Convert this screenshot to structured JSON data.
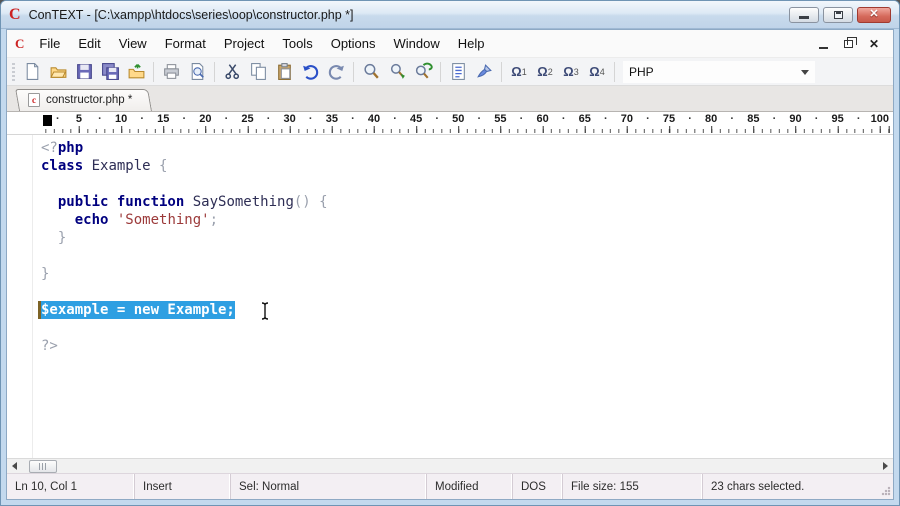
{
  "window": {
    "title": "ConTEXT - [C:\\xampp\\htdocs\\series\\oop\\constructor.php *]"
  },
  "icons": {
    "logo": "C",
    "tab_badge": "c",
    "close": "✕",
    "omega": "Ω"
  },
  "menubar": {
    "items": [
      "File",
      "Edit",
      "View",
      "Format",
      "Project",
      "Tools",
      "Options",
      "Window",
      "Help"
    ]
  },
  "toolbar": {
    "icon_names": [
      "new-file",
      "open-file",
      "save-file",
      "save-all",
      "open-folder",
      "print",
      "print-preview",
      "cut",
      "copy",
      "paste",
      "undo",
      "redo",
      "find",
      "find-next",
      "replace",
      "view-source",
      "format-brush",
      "user-function-1",
      "user-function-2",
      "user-function-3",
      "user-function-4"
    ],
    "omega_buttons": [
      {
        "glyph": "Ω",
        "sub": "1"
      },
      {
        "glyph": "Ω",
        "sub": "2"
      },
      {
        "glyph": "Ω",
        "sub": "3"
      },
      {
        "glyph": "Ω",
        "sub": "4"
      }
    ],
    "highlighter": {
      "value": "PHP"
    }
  },
  "tab": {
    "label": "constructor.php *"
  },
  "ruler": {
    "numbers": [
      5,
      10,
      15,
      20,
      25,
      30,
      35,
      40,
      45,
      50,
      55,
      60,
      65,
      70,
      75,
      80,
      85,
      90,
      95,
      100
    ],
    "cursor_col": 1
  },
  "editor": {
    "selection_colors": {
      "background": "#2e9fe2",
      "text": "#ffffff"
    },
    "token_colors": {
      "keyword": "#00007f",
      "identifier": "#2e2e55",
      "string": "#9c3a3a",
      "symbol": "#9aa0ad"
    },
    "lines": [
      [
        {
          "t": "<?",
          "c": "sym"
        },
        {
          "t": "php",
          "c": "kw"
        }
      ],
      [
        {
          "t": "class",
          "c": "kw"
        },
        {
          "t": " Example ",
          "c": "id"
        },
        {
          "t": "{",
          "c": "sym"
        }
      ],
      [],
      [
        {
          "t": "  ",
          "c": "id"
        },
        {
          "t": "public function",
          "c": "kw"
        },
        {
          "t": " SaySomething",
          "c": "id"
        },
        {
          "t": "()",
          "c": "sym"
        },
        {
          "t": " {",
          "c": "sym"
        }
      ],
      [
        {
          "t": "    ",
          "c": "id"
        },
        {
          "t": "echo",
          "c": "kw"
        },
        {
          "t": " ",
          "c": "id"
        },
        {
          "t": "'Something'",
          "c": "str"
        },
        {
          "t": ";",
          "c": "sym"
        }
      ],
      [
        {
          "t": "  }",
          "c": "sym"
        }
      ],
      [],
      [
        {
          "t": "}",
          "c": "sym"
        }
      ],
      [],
      [
        {
          "t": "$example = new Example;",
          "c": "sel"
        }
      ],
      [],
      [
        {
          "t": "?>",
          "c": "sym"
        }
      ]
    ]
  },
  "statusbar": {
    "panels": [
      "Ln 10, Col 1",
      "Insert",
      "Sel: Normal",
      "Modified",
      "DOS",
      "File size: 155",
      "23 chars selected."
    ]
  }
}
